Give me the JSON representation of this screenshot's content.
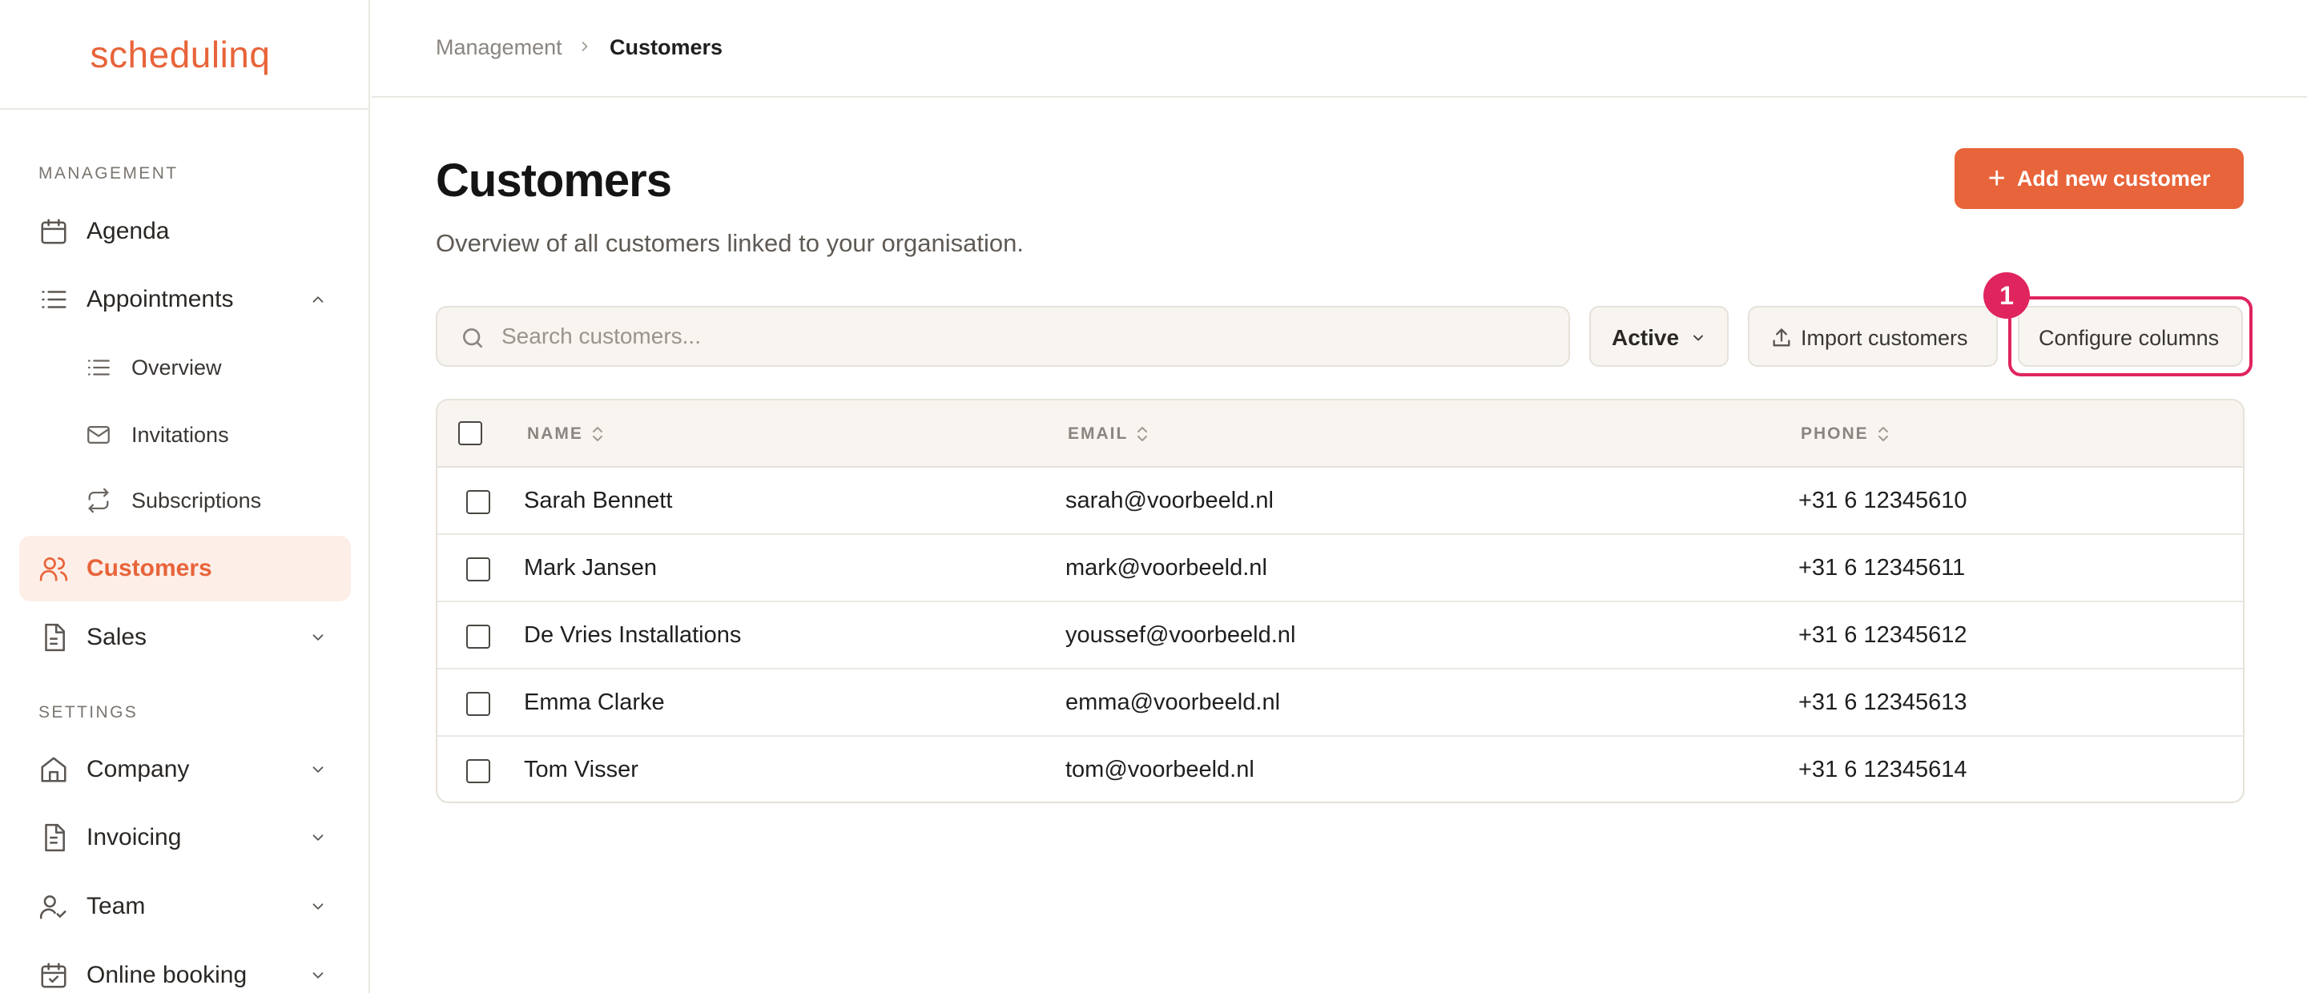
{
  "brand": {
    "logo_text": "schedulinq",
    "accent": "#e8643a",
    "highlight": "#e0245e"
  },
  "sidebar": {
    "management_label": "MANAGEMENT",
    "settings_label": "SETTINGS",
    "items": {
      "agenda": {
        "label": "Agenda",
        "icon": "calendar-icon"
      },
      "appointments": {
        "label": "Appointments",
        "icon": "list-icon",
        "expanded": true
      },
      "overview": {
        "label": "Overview",
        "icon": "list-icon"
      },
      "invitations": {
        "label": "Invitations",
        "icon": "mail-icon"
      },
      "subscriptions": {
        "label": "Subscriptions",
        "icon": "repeat-icon"
      },
      "customers": {
        "label": "Customers",
        "icon": "users-icon",
        "active": true
      },
      "sales": {
        "label": "Sales",
        "icon": "document-icon"
      },
      "company": {
        "label": "Company",
        "icon": "home-icon"
      },
      "invoicing": {
        "label": "Invoicing",
        "icon": "invoice-icon"
      },
      "team": {
        "label": "Team",
        "icon": "user-check-icon"
      },
      "online_booking": {
        "label": "Online booking",
        "icon": "calendar-check-icon"
      }
    }
  },
  "breadcrumb": {
    "parent": "Management",
    "current": "Customers"
  },
  "page": {
    "title": "Customers",
    "subtitle": "Overview of all customers linked to your organisation.",
    "add_button": "Add new customer"
  },
  "toolbar": {
    "search_placeholder": "Search customers...",
    "status_filter": "Active",
    "import_button": "Import customers",
    "configure_button": "Configure columns",
    "step_badge": "1"
  },
  "table": {
    "headers": {
      "name": "NAME",
      "email": "EMAIL",
      "phone": "PHONE"
    },
    "rows": [
      {
        "name": "Sarah Bennett",
        "email": "sarah@voorbeeld.nl",
        "phone": "+31 6 12345610"
      },
      {
        "name": "Mark Jansen",
        "email": "mark@voorbeeld.nl",
        "phone": "+31 6 12345611"
      },
      {
        "name": "De Vries Installations",
        "email": "youssef@voorbeeld.nl",
        "phone": "+31 6 12345612"
      },
      {
        "name": "Emma Clarke",
        "email": "emma@voorbeeld.nl",
        "phone": "+31 6 12345613"
      },
      {
        "name": "Tom Visser",
        "email": "tom@voorbeeld.nl",
        "phone": "+31 6 12345614"
      }
    ]
  }
}
